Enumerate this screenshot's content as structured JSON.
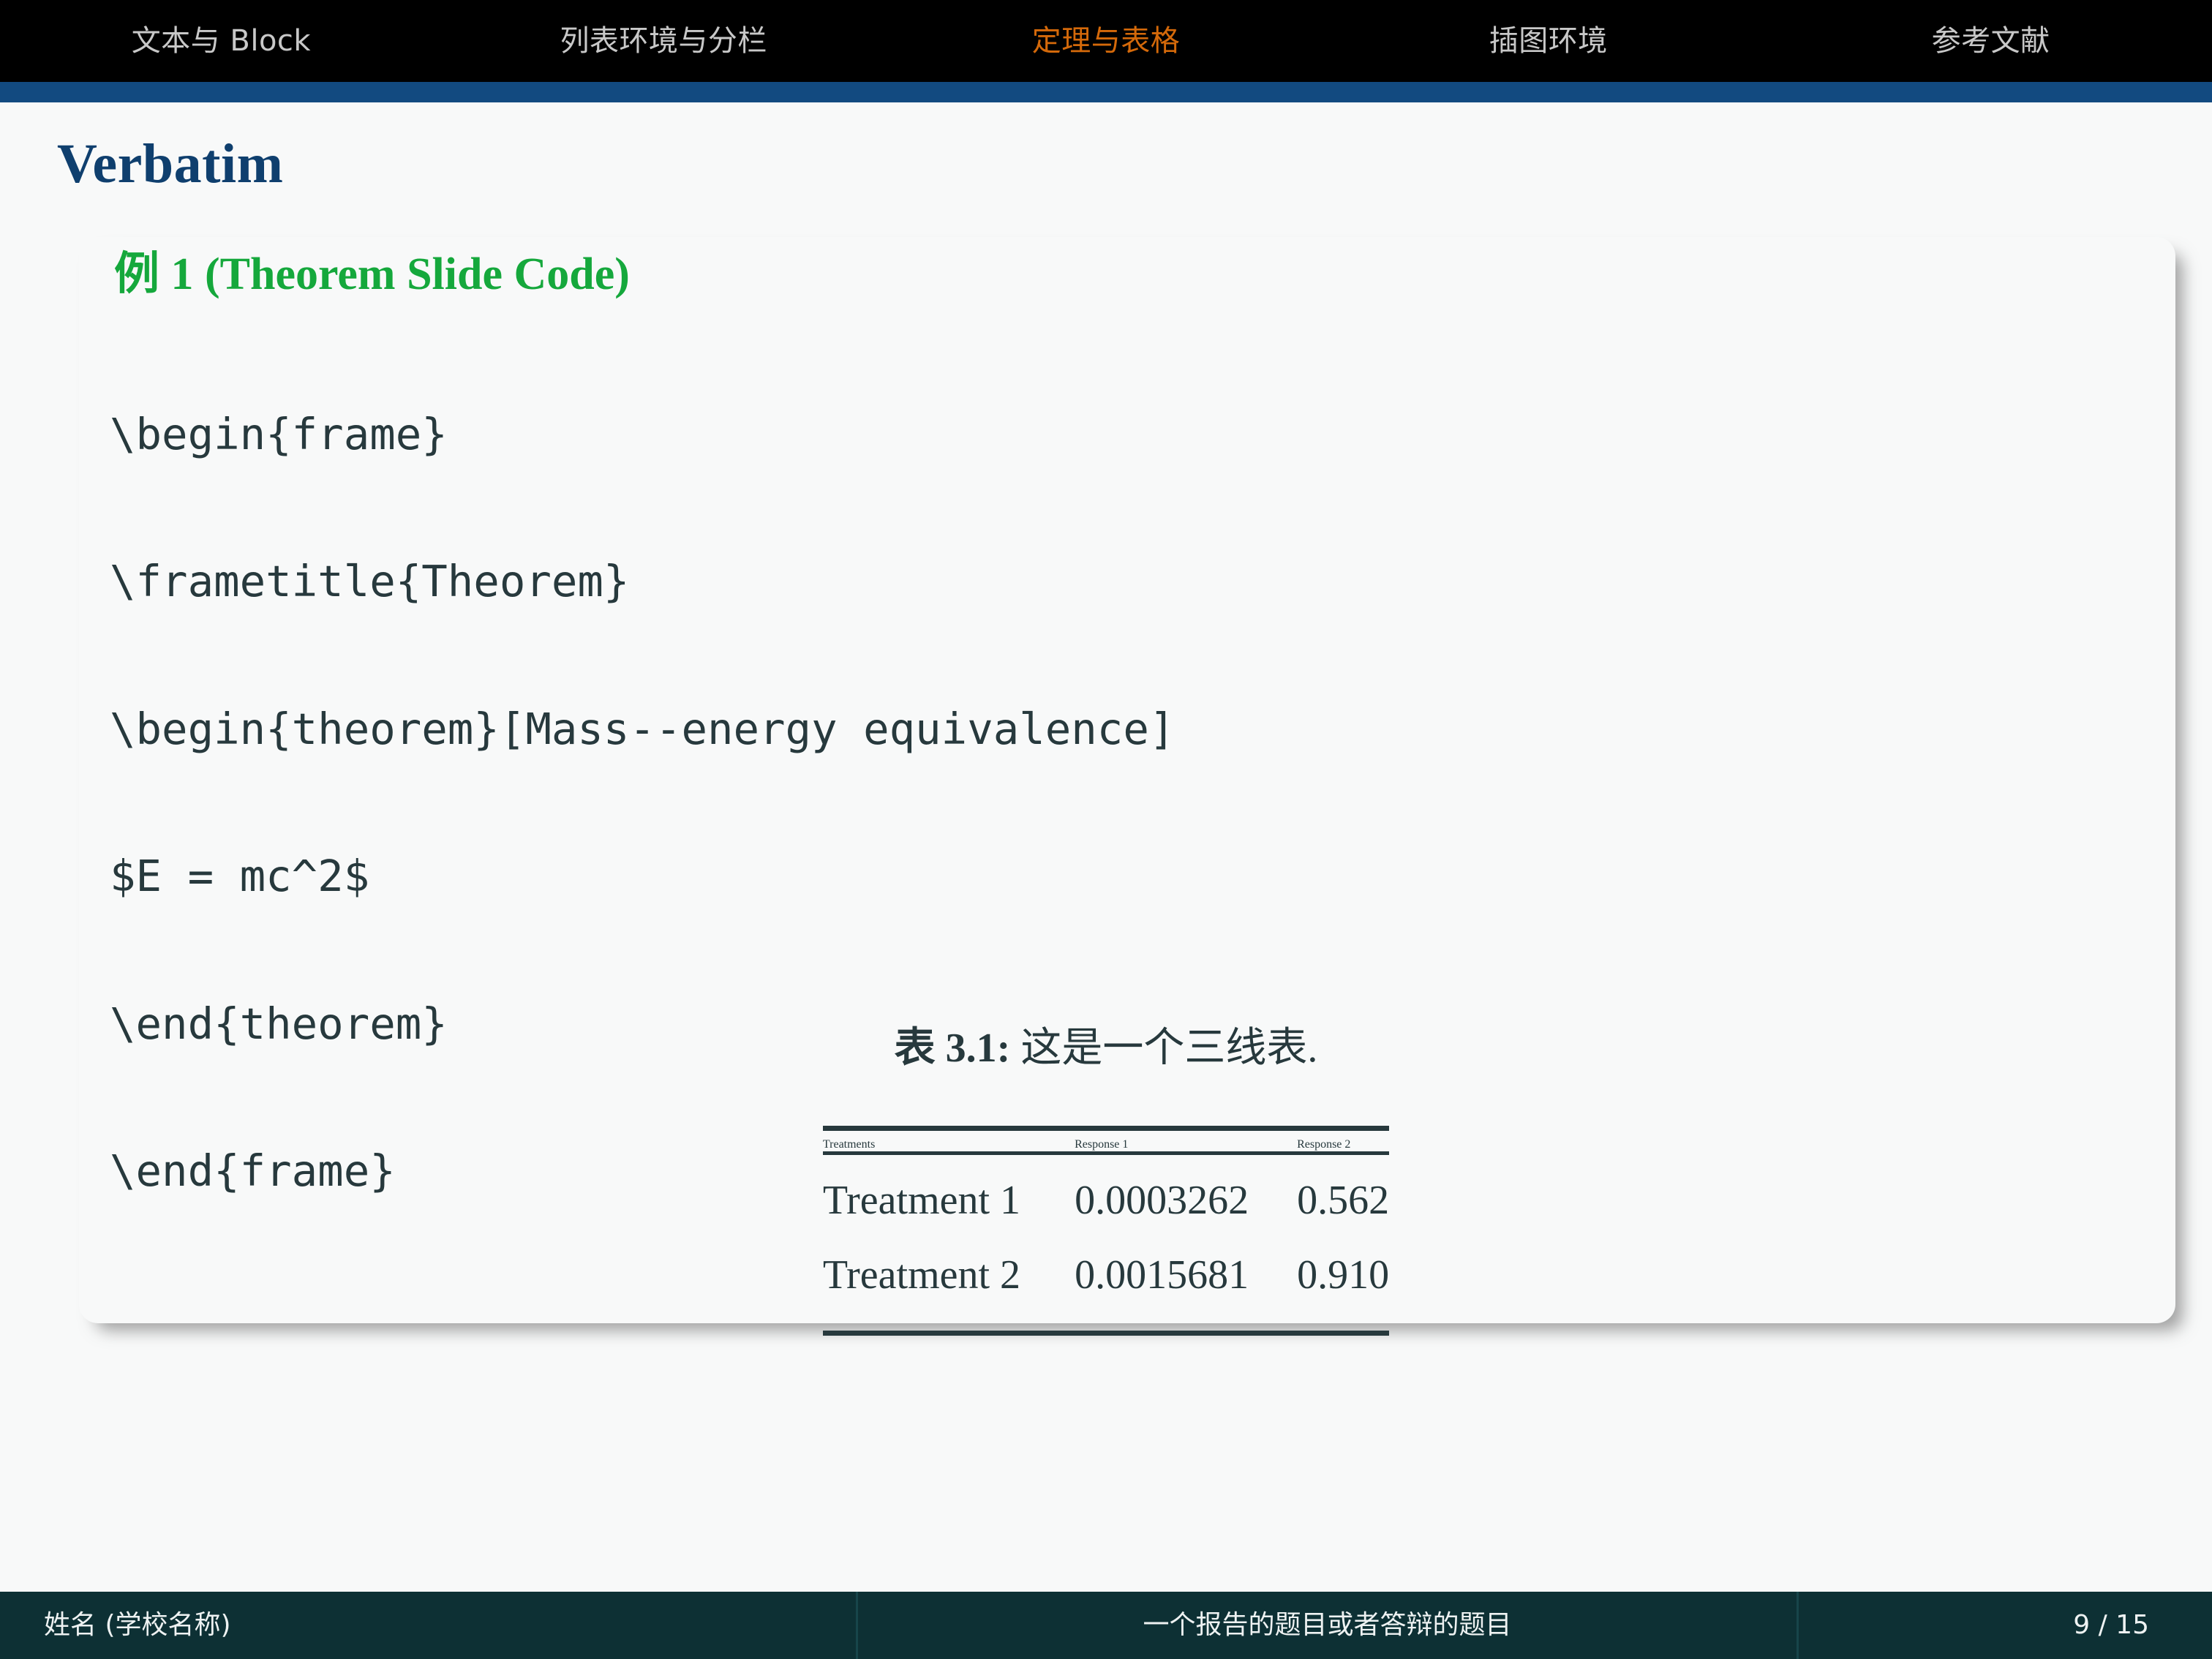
{
  "navigation": {
    "items": [
      {
        "label": "文本与 Block",
        "active": false
      },
      {
        "label": "列表环境与分栏",
        "active": false
      },
      {
        "label": "定理与表格",
        "active": true
      },
      {
        "label": "插图环境",
        "active": false
      },
      {
        "label": "参考文献",
        "active": false
      }
    ],
    "bar_color": "#000000",
    "rule_color": "#124a80",
    "active_color": "#d4690a",
    "inactive_color": "#c8c8c8"
  },
  "frame": {
    "title": "Verbatim",
    "title_color": "#0f3f6e"
  },
  "block": {
    "title": "例 1 (Theorem Slide Code)",
    "title_color": "#15a83c",
    "code_color": "#27393d",
    "code_lines": [
      "\\begin{frame}",
      "\\frametitle{Theorem}",
      "\\begin{theorem}[Mass--energy equivalence]",
      "$E = mc^2$",
      "\\end{theorem}",
      "\\end{frame}"
    ]
  },
  "table": {
    "caption_label": "表 3.1:",
    "caption_text": "这是一个三线表.",
    "rule_color": "#27393d",
    "headers": [
      "Treatments",
      "Response 1",
      "Response 2"
    ],
    "rows": [
      [
        "Treatment 1",
        "0.0003262",
        "0.562"
      ],
      [
        "Treatment 2",
        "0.0015681",
        "0.910"
      ]
    ]
  },
  "chart_data": {
    "type": "table",
    "title": "表 3.1: 这是一个三线表.",
    "categories": [
      "Treatment 1",
      "Treatment 2"
    ],
    "series": [
      {
        "name": "Response 1",
        "values": [
          0.0003262,
          0.0015681
        ]
      },
      {
        "name": "Response 2",
        "values": [
          0.562,
          0.91
        ]
      }
    ],
    "columns": [
      "Treatments",
      "Response 1",
      "Response 2"
    ],
    "cells": [
      [
        "Treatment 1",
        "0.0003262",
        "0.562"
      ],
      [
        "Treatment 2",
        "0.0015681",
        "0.910"
      ]
    ],
    "grid": false,
    "legend": "none"
  },
  "footer": {
    "author": "姓名 (学校名称)",
    "title": "一个报告的题目或者答辩的题目",
    "page": "9 / 15",
    "background": "#0d3034"
  }
}
